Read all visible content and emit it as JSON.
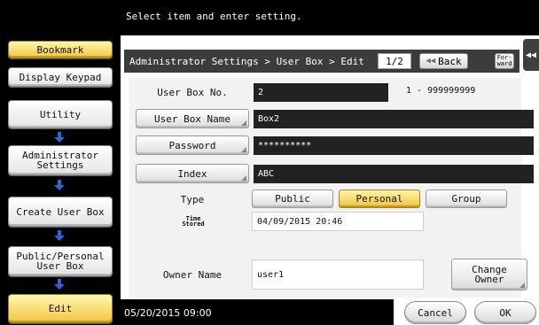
{
  "header": {
    "message": "Select item and enter setting."
  },
  "sidebar": {
    "items": [
      {
        "label": "Bookmark"
      },
      {
        "label": "Display Keypad"
      },
      {
        "label": "Utility"
      },
      {
        "label": "Administrator\nSettings"
      },
      {
        "label": "Create User Box"
      },
      {
        "label": "Public/Personal\nUser Box"
      },
      {
        "label": "Edit"
      }
    ]
  },
  "titlebar": {
    "breadcrumb": "Administrator Settings > User Box > Edit",
    "page_indicator": "1/2",
    "back_label": "Back",
    "forward_label": "For-\nward"
  },
  "form": {
    "box_no_label": "User Box No.",
    "box_no_value": "2",
    "box_no_range": "1 - 999999999",
    "box_name_label": "User Box Name",
    "box_name_value": "Box2",
    "password_label": "Password",
    "password_value": "**********",
    "index_label": "Index",
    "index_value": "ABC",
    "type_label": "Type",
    "type_options": [
      {
        "label": "Public",
        "selected": false
      },
      {
        "label": "Personal",
        "selected": true
      },
      {
        "label": "Group",
        "selected": false
      }
    ],
    "time_stored_label": "Time\nStored",
    "time_stored_value": "04/09/2015   20:46",
    "owner_label": "Owner Name",
    "owner_value": "user1",
    "change_owner_label": "Change\nOwner"
  },
  "footer": {
    "datetime": "05/20/2015  09:00",
    "cancel_label": "Cancel",
    "ok_label": "OK"
  },
  "colors": {
    "accent_gold": "#f3c53f",
    "arrow_blue": "#2a66d9",
    "dark_field": "#222222"
  }
}
